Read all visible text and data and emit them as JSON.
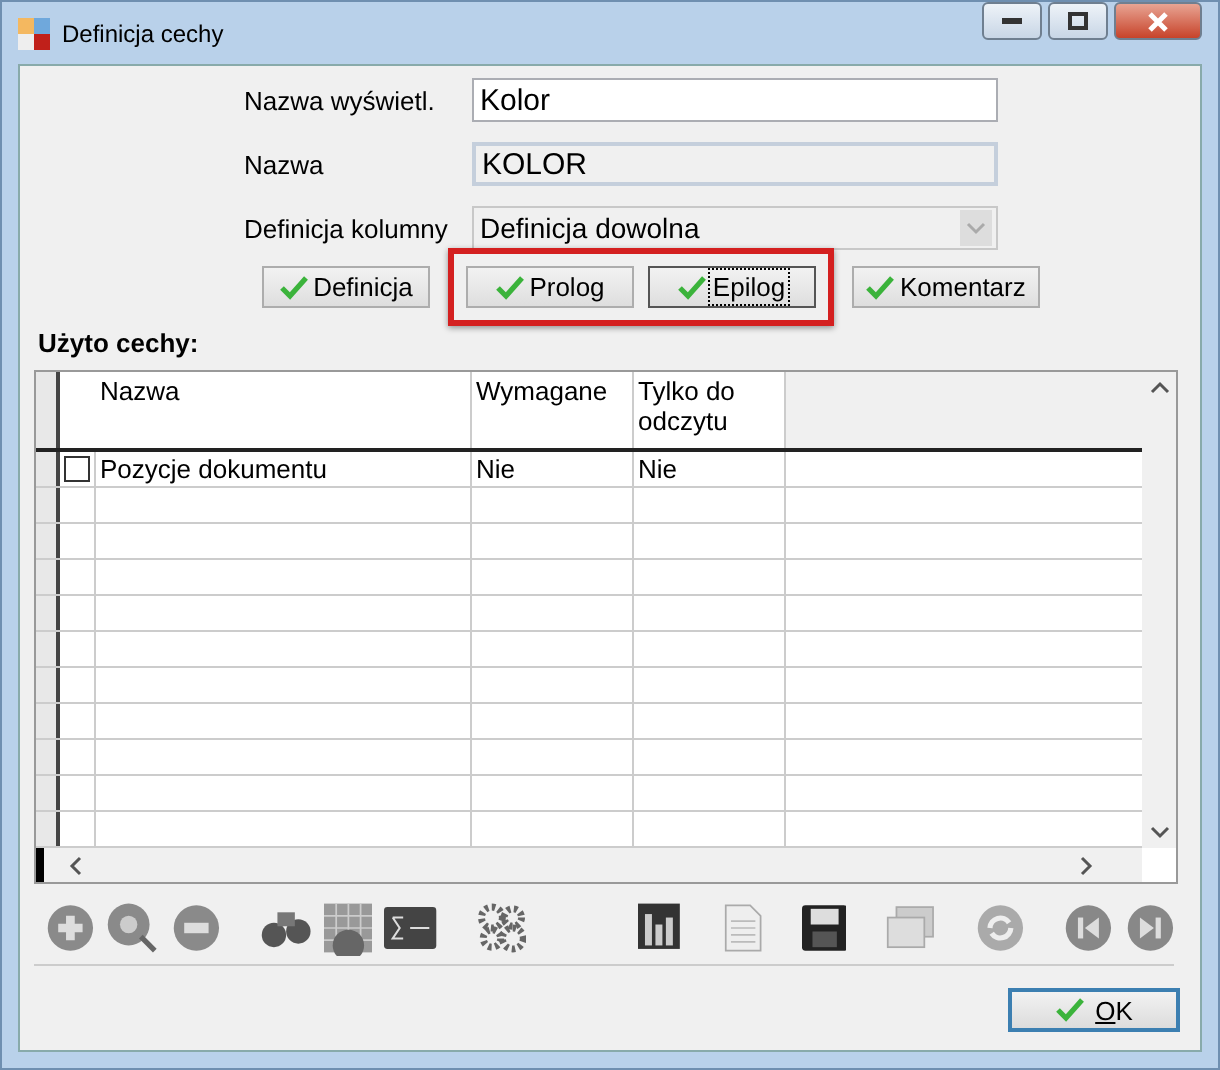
{
  "window": {
    "title": "Definicja cechy"
  },
  "fields": [
    {
      "label": "Nazwa wyświetl.",
      "kind": "text",
      "value": "Kolor",
      "disabled": false
    },
    {
      "label": "Nazwa",
      "kind": "text",
      "value": "KOLOR",
      "disabled": true
    },
    {
      "label": "Definicja kolumny",
      "kind": "combo",
      "value": "Definicja dowolna",
      "disabled": true
    }
  ],
  "buttons": [
    {
      "label": "Definicja",
      "focused": false,
      "highlighted": false
    },
    {
      "label": "Prolog",
      "focused": false,
      "highlighted": true
    },
    {
      "label": "Epilog",
      "focused": true,
      "highlighted": true
    },
    {
      "label": "Komentarz",
      "focused": false,
      "highlighted": false
    }
  ],
  "section_title": "Użyto cechy:",
  "table": {
    "columns": [
      "Nazwa",
      "Wymagane",
      "Tylko do odczytu"
    ],
    "rows": [
      {
        "checked": false,
        "cells": [
          "Pozycje dokumentu",
          "Nie",
          "Nie"
        ]
      }
    ]
  },
  "ok_button": {
    "label": "OK"
  }
}
